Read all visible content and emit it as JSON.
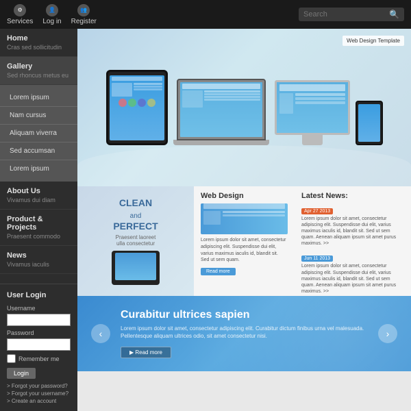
{
  "topbar": {
    "services_label": "Services",
    "login_label": "Log in",
    "register_label": "Register",
    "search_placeholder": "Search"
  },
  "sidebar": {
    "items": [
      {
        "id": "home",
        "title": "Home",
        "sub": "Cras sed sollicitudin"
      },
      {
        "id": "gallery",
        "title": "Gallery",
        "sub": "Sed rhoncus metus eu"
      },
      {
        "id": "about",
        "title": "About Us",
        "sub": "Vivamus dui diam"
      },
      {
        "id": "products",
        "title": "Product & Projects",
        "sub": "Praesent commodo"
      },
      {
        "id": "news",
        "title": "News",
        "sub": "Vivamus iaculis"
      }
    ],
    "submenu": [
      {
        "label": "Lorem ipsum"
      },
      {
        "label": "Nam cursus"
      },
      {
        "label": "Aliquam viverra"
      },
      {
        "label": "Sed accumsan"
      },
      {
        "label": "Lorem ipsum"
      }
    ]
  },
  "user_login": {
    "title": "User Login",
    "username_label": "Username",
    "password_label": "Password",
    "remember_label": "Remember me",
    "login_btn": "Login",
    "links": [
      "Forgot your password?",
      "Forgot your username?",
      "Create an account"
    ]
  },
  "hero": {
    "web_design_label": "Web Design Template"
  },
  "mid": {
    "clean_line1": "CLEAN",
    "clean_and": "and",
    "clean_line2": "PERFECT",
    "clean_sub": "Praesent laoreet\nulla consectetur",
    "web_design_title": "Web Design",
    "web_design_text": "Lorem ipsum dolor sit amet, consectetur adipiscing elit. Suspendisse dui elit, varius maximus iaculis id, blandit sit. Sed ut sem quam.",
    "read_more_btn": "Read more",
    "latest_news_title": "Latest News:",
    "news_items": [
      {
        "badge": "Apr 27 2013",
        "badge_color": "orange",
        "text": "Lorem ipsum dolor sit amet, consectetur adipiscing elit. Suspendisse dui elit, varius maximus iaculis id, blandit sit. Sed ut sem quam. Aenean aliquam ipsum sit amet purus maximus. >>",
        "link": ""
      },
      {
        "badge": "Jun 11 2013",
        "badge_color": "blue",
        "text": "Lorem ipsum dolor sit amet, consectetur adipiscing elit. Suspendisse dui elit, varius maximus iaculis id, blandit sit. Sed ut sem quam. Aenean aliquam ipsum sit amet purus maximus. >>",
        "link": ""
      }
    ]
  },
  "cta": {
    "title": "Curabitur ultrices sapien",
    "text": "Lorem ipsum dolor sit amet, consectetur adipiscing elit. Curabitur dictum finibus urna vel malesuada. Pellentesque aliquam ultrices odio, sit amet consectetur nisi.",
    "read_more_btn": "Read more",
    "arrow_left": "‹",
    "arrow_right": "›"
  }
}
